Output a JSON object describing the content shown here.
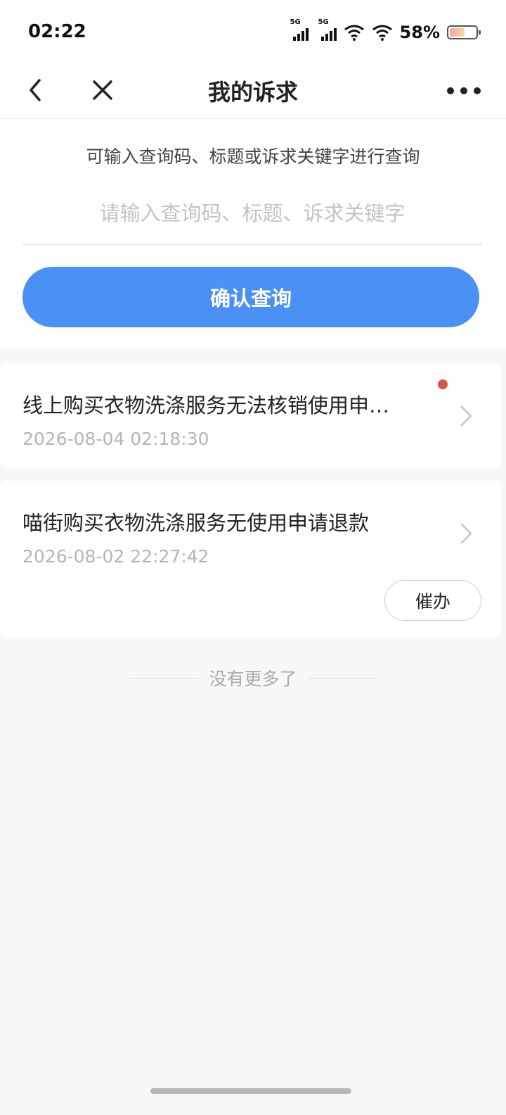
{
  "status_bar": {
    "time": "02:22",
    "signal1_label": "5G",
    "signal2_label": "5G",
    "battery_percent": "58%",
    "battery_level": 0.58
  },
  "nav": {
    "title": "我的诉求",
    "back_icon": "chevron-left-icon",
    "close_icon": "close-icon",
    "more_icon": "more-dots-icon"
  },
  "search": {
    "hint": "可输入查询码、标题或诉求关键字进行查询",
    "placeholder": "请输入查询码、标题、诉求关键字",
    "value": "",
    "confirm_label": "确认查询"
  },
  "items": [
    {
      "title": "线上购买衣物洗涤服务无法核销使用申…",
      "date": "2026-08-04 02:18:30",
      "unread": true
    },
    {
      "title": "喵街购买衣物洗涤服务无使用申请退款",
      "date": "2026-08-02 22:27:42",
      "action_label": "催办"
    }
  ],
  "list_end": "没有更多了",
  "colors": {
    "accent": "#4a90f5",
    "unread_dot": "#d9534f",
    "background": "#f8f8f8"
  }
}
